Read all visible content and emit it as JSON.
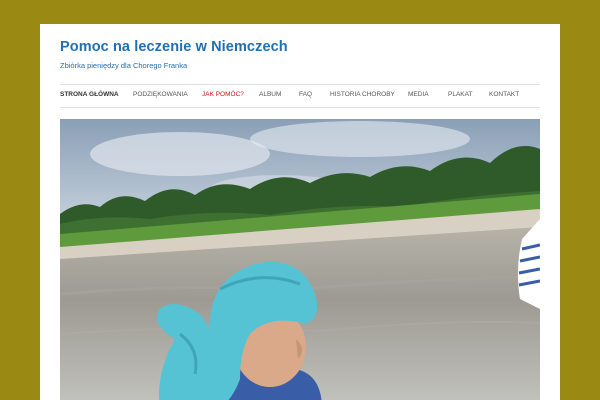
{
  "site": {
    "title": "Pomoc na leczenie w Niemczech",
    "description": "Zbiórka pieniędzy dla Chorego Franka"
  },
  "nav": {
    "items": [
      {
        "label": "STRONA GŁÓWNA"
      },
      {
        "label": "PODZIĘKOWANIA"
      },
      {
        "label": "JAK POMÓC?"
      },
      {
        "label": "ALBUM"
      },
      {
        "label": "FAQ"
      },
      {
        "label": "HISTORIA CHOROBY"
      },
      {
        "label": "MEDIA"
      },
      {
        "label": "PLAKAT"
      },
      {
        "label": "KONTAKT"
      }
    ]
  },
  "colors": {
    "background": "#9a8a14",
    "link": "#1f6fb2",
    "active_nav": "#d01616"
  }
}
